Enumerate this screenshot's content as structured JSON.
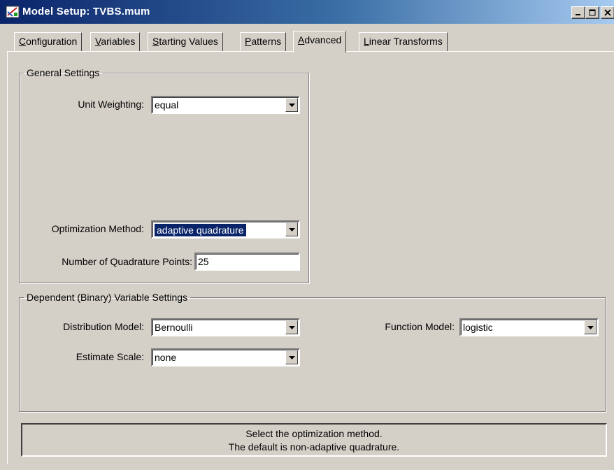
{
  "window": {
    "title": "Model Setup: TVBS.mum",
    "icon": "model-setup-icon",
    "controls": {
      "minimize": "minimize-icon",
      "maximize": "maximize-icon",
      "close": "close-icon"
    }
  },
  "tabs": [
    {
      "pre": "",
      "key": "C",
      "post": "onfiguration",
      "active": false
    },
    {
      "pre": "",
      "key": "V",
      "post": "ariables",
      "active": false
    },
    {
      "pre": "",
      "key": "S",
      "post": "tarting Values",
      "active": false
    },
    {
      "pre": "",
      "key": "P",
      "post": "atterns",
      "active": false
    },
    {
      "pre": "",
      "key": "A",
      "post": "dvanced",
      "active": true
    },
    {
      "pre": "",
      "key": "L",
      "post": "inear Transforms",
      "active": false
    }
  ],
  "general": {
    "legend": "General Settings",
    "unit_weighting": {
      "label": "Unit Weighting:",
      "value": "equal"
    },
    "optimization": {
      "label": "Optimization Method:",
      "value": "adaptive quadrature"
    },
    "quadrature_points": {
      "label": "Number of Quadrature Points:",
      "value": "25"
    }
  },
  "dependent": {
    "legend": "Dependent (Binary) Variable Settings",
    "distribution": {
      "label": "Distribution Model:",
      "value": "Bernoulli"
    },
    "function": {
      "label": "Function Model:",
      "value": "logistic"
    },
    "scale": {
      "label": "Estimate Scale:",
      "value": "none"
    }
  },
  "status": {
    "line1": "Select the optimization method.",
    "line2": "The default is non-adaptive quadrature."
  },
  "colors": {
    "face": "#d4d0c8",
    "title_start": "#0a246a",
    "title_end": "#a6caf0",
    "selection": "#0a246a"
  }
}
